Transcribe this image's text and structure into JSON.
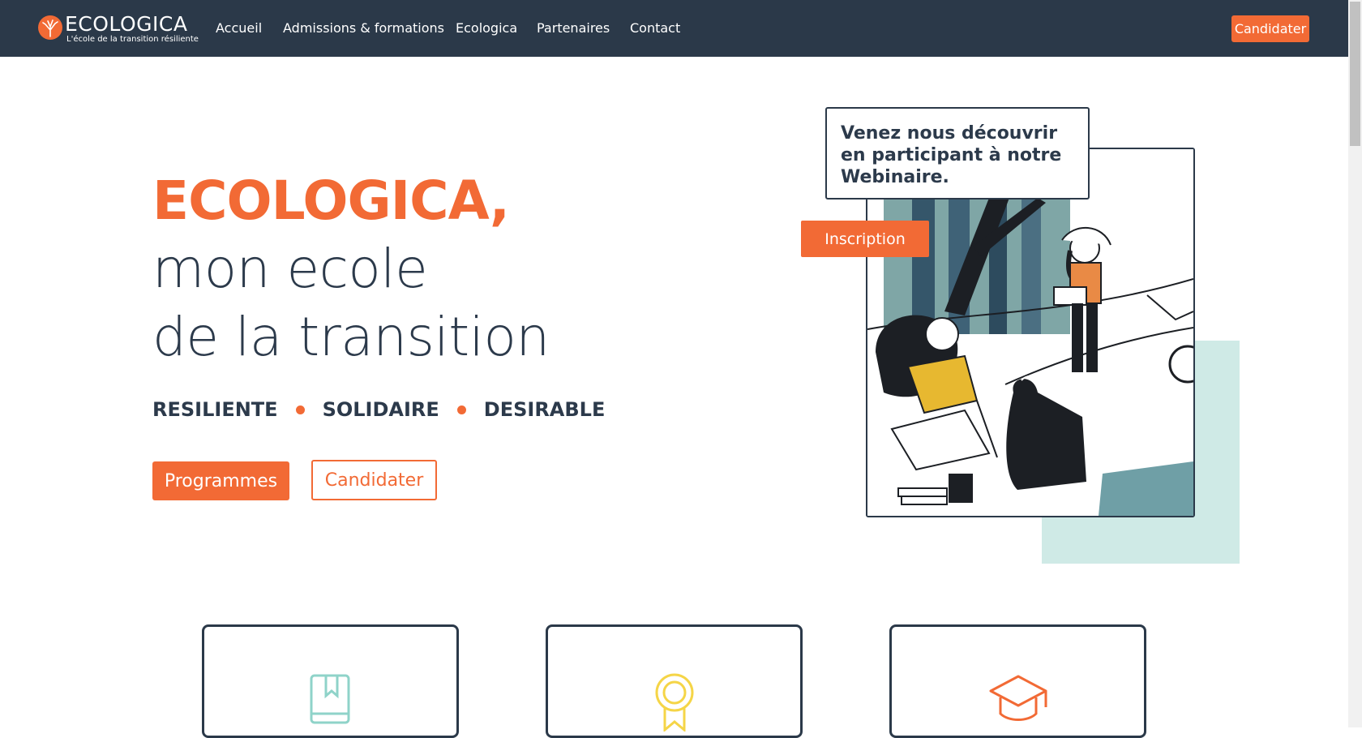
{
  "navbar": {
    "logo": {
      "name": "ECOLOGICA",
      "tagline": "L'école de la transition résiliente"
    },
    "links": [
      {
        "label": "Accueil"
      },
      {
        "label": "Admissions & formations"
      },
      {
        "label": "Ecologica"
      },
      {
        "label": "Partenaires"
      },
      {
        "label": "Contact"
      }
    ],
    "cta_label": "Candidater"
  },
  "hero": {
    "title_line1": "ECOLOGICA,",
    "title_line2": "mon ecole",
    "title_line3": "de la transition",
    "tagline": [
      "RESILIENTE",
      "SOLIDAIRE",
      "DESIRABLE"
    ],
    "primary_button": "Programmes",
    "secondary_button": "Candidater"
  },
  "webinar": {
    "text": "Venez nous découvrir en participant à notre Webinaire.",
    "button": "Inscription"
  },
  "features": [
    {
      "icon": "book-icon",
      "color": "#8fd3c9"
    },
    {
      "icon": "award-icon",
      "color": "#f5d547"
    },
    {
      "icon": "graduation-cap-icon",
      "color": "#f26a35"
    }
  ],
  "colors": {
    "navbar_bg": "#2b3949",
    "accent": "#f26a35",
    "text_dark": "#2c3a4b",
    "mint": "#cfeae6"
  }
}
